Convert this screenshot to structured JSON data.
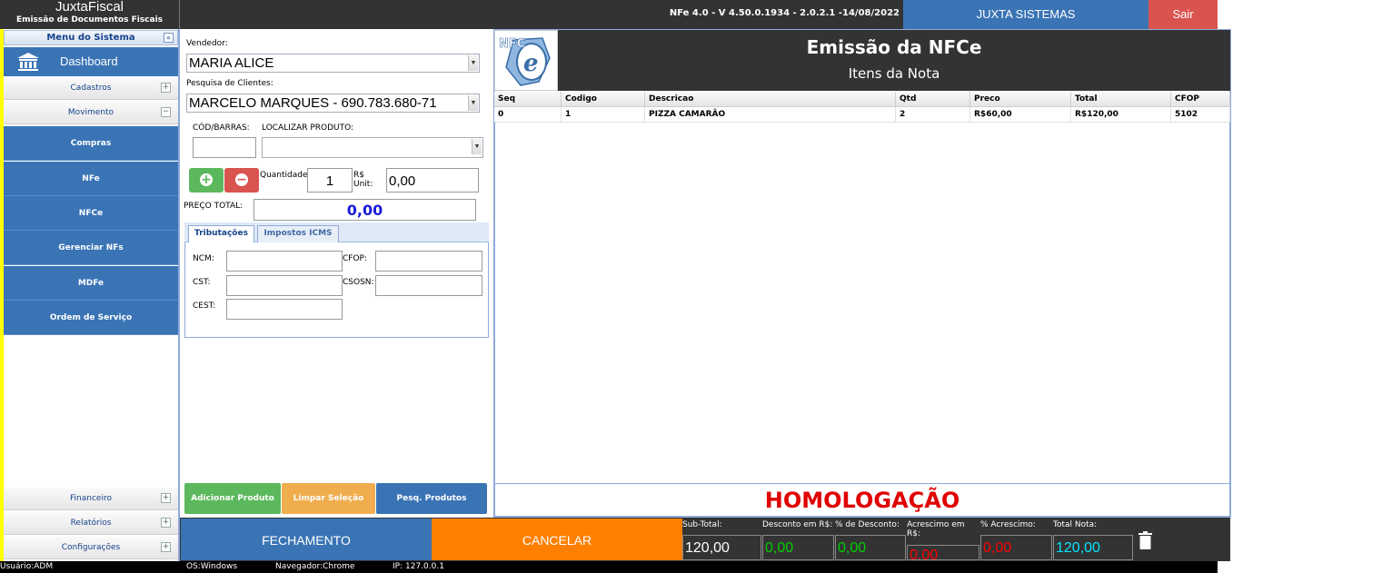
{
  "app": {
    "title": "JuxtaFiscal",
    "subtitle": "Emissão de Documentos Fiscais",
    "version": "NFe 4.0 - V 4.50.0.1934 - 2.0.2.1 -14/08/2022",
    "company_button": "JUXTA SISTEMAS",
    "exit_button": "Sair"
  },
  "sidebar": {
    "menu_title": "Menu do Sistema",
    "collapse_symbol": "«",
    "dashboard_label": "Dashboard",
    "cadastros": "Cadastros",
    "movimento": "Movimento",
    "movimento_items": [
      "Compras",
      "NFe",
      "NFCe",
      "Gerenciar NFs",
      "MDFe",
      "Ordem de Serviço"
    ],
    "financeiro": "Financeiro",
    "relatorios": "Relatórios",
    "configuracoes": "Configurações",
    "plus": "+",
    "minus": "−"
  },
  "form": {
    "vendedor_label": "Vendedor:",
    "vendedor_value": "MARIA ALICE",
    "cliente_label": "Pesquisa de Clientes:",
    "cliente_value": "MARCELO MARQUES - 690.783.680-71",
    "codbarras_label": "CÓD/BARRAS:",
    "localizar_label": "LOCALIZAR PRODUTO:",
    "quantidade_label": "Quantidade",
    "quantidade_value": "1",
    "unit_label_1": "R$",
    "unit_label_2": "Unit:",
    "unit_value": "0,00",
    "preco_total_label": "PREÇO TOTAL:",
    "preco_total_value": "0,00",
    "tab_tributacoes": "Tributações",
    "tab_impostos": "Impostos ICMS",
    "ncm_label": "NCM:",
    "cfop_label": "CFOP:",
    "cst_label": "CST:",
    "csosn_label": "CSOSN:",
    "cest_label": "CEST:",
    "btn_adicionar": "Adicionar Produto",
    "btn_limpar": "Limpar Seleção",
    "btn_pesq": "Pesq. Produtos",
    "combo_arrow": "▼",
    "add_symbol": "+",
    "remove_symbol": "−"
  },
  "main": {
    "logo_text": "NFC",
    "logo_e": "e",
    "title": "Emissão da NFCe",
    "subtitle": "Itens da Nota",
    "columns": [
      "Seq",
      "Codigo",
      "Descricao",
      "Qtd",
      "Preco",
      "Total",
      "CFOP"
    ],
    "rows": [
      [
        "0",
        "1",
        "PIZZA CAMARÃO",
        "2",
        "R$60,00",
        "R$120,00",
        "5102"
      ]
    ],
    "environment": "HOMOLOGAÇÃO"
  },
  "bottom": {
    "fechamento": "FECHAMENTO",
    "cancelar": "CANCELAR",
    "subtotal_label": "Sub-Total:",
    "subtotal_value": "120,00",
    "desconto_rs_label": "Desconto em R$:",
    "desconto_rs_value": "0,00",
    "desconto_pct_label": "% de Desconto:",
    "desconto_pct_value": "0,00",
    "acrescimo_rs_label": "Acrescimo em R$:",
    "acrescimo_rs_value": "0,00",
    "acrescimo_pct_label": "% Acrescimo:",
    "acrescimo_pct_value": "0,00",
    "total_label": "Total Nota:",
    "total_value": "120,00"
  },
  "status": {
    "usuario": "Usuário:ADM",
    "os": "OS:Windows",
    "navegador": "Navegador:Chrome",
    "ip": "IP: 127.0.0.1"
  },
  "colors": {
    "accent_blue": "#3a74b5",
    "exit_red": "#d9534f",
    "cancel_orange": "#ff8000",
    "add_green": "#5cb85c",
    "clear_orange": "#f0ad4e",
    "homolog_red": "#e00000",
    "discount_green": "#00d000",
    "increase_red": "#ff0000",
    "total_cyan": "#00e5ff"
  },
  "icons": {
    "dashboard": "bank-icon",
    "trash": "trash-icon"
  }
}
